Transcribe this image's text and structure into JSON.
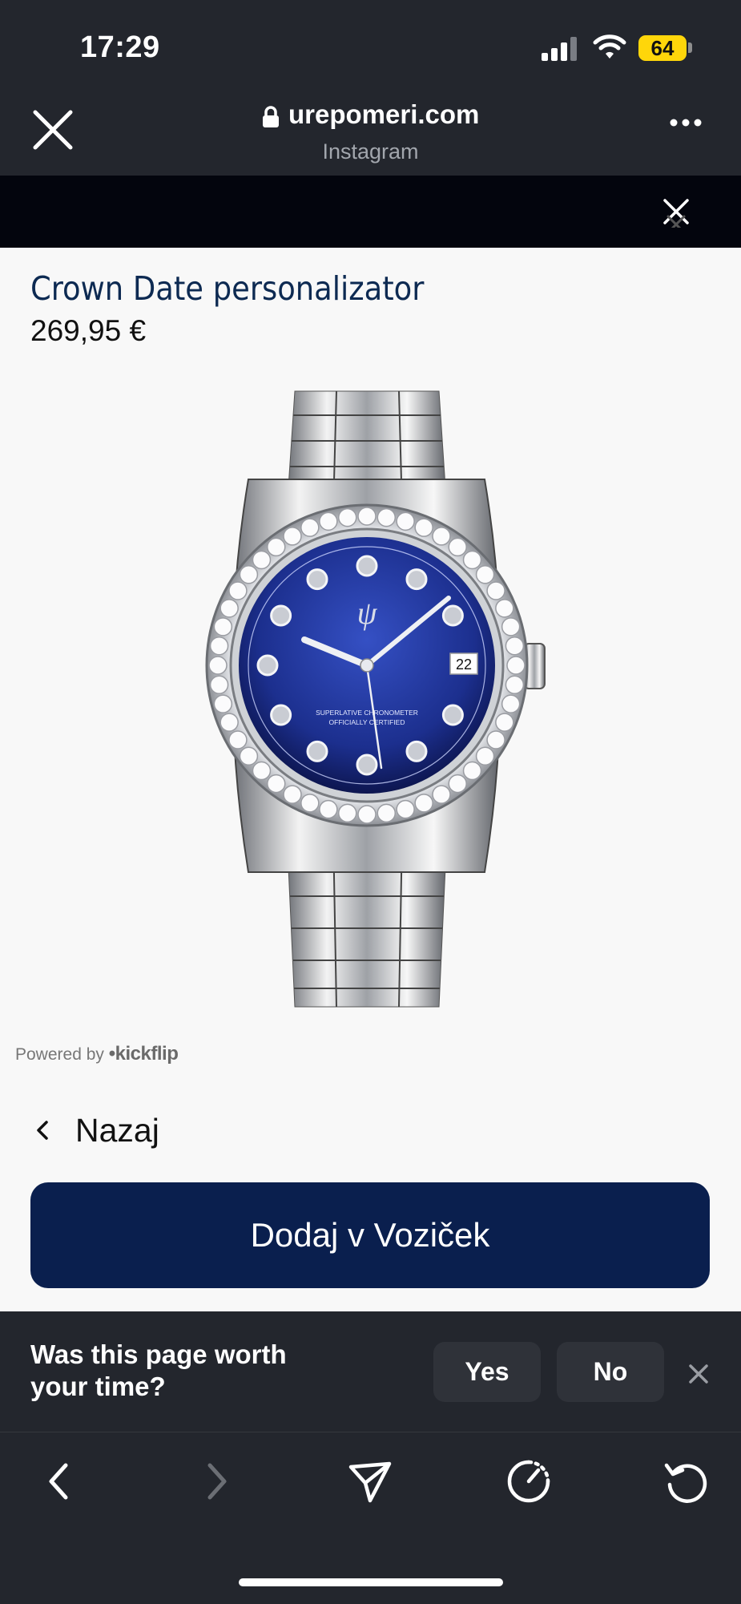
{
  "status": {
    "time": "17:29",
    "battery": "64"
  },
  "browser": {
    "url": "urepomeri.com",
    "source": "Instagram"
  },
  "product": {
    "title": "Crown Date personalizator",
    "price": "269,95 €",
    "dial_date": "22",
    "dial_text_line1": "SUPERLATIVE CHRONOMETER",
    "dial_text_line2": "OFFICIALLY CERTIFIED"
  },
  "powered": {
    "prefix": "Powered by",
    "brand": "•kickflip"
  },
  "nav": {
    "back_label": "Nazaj"
  },
  "cart": {
    "add_label": "Dodaj v Voziček"
  },
  "feedback": {
    "question": "Was this page worth your time?",
    "yes": "Yes",
    "no": "No"
  },
  "colors": {
    "brand_navy": "#0a1f4e",
    "dial_blue": "#1c2f8e",
    "bar_bg": "#23262d"
  }
}
